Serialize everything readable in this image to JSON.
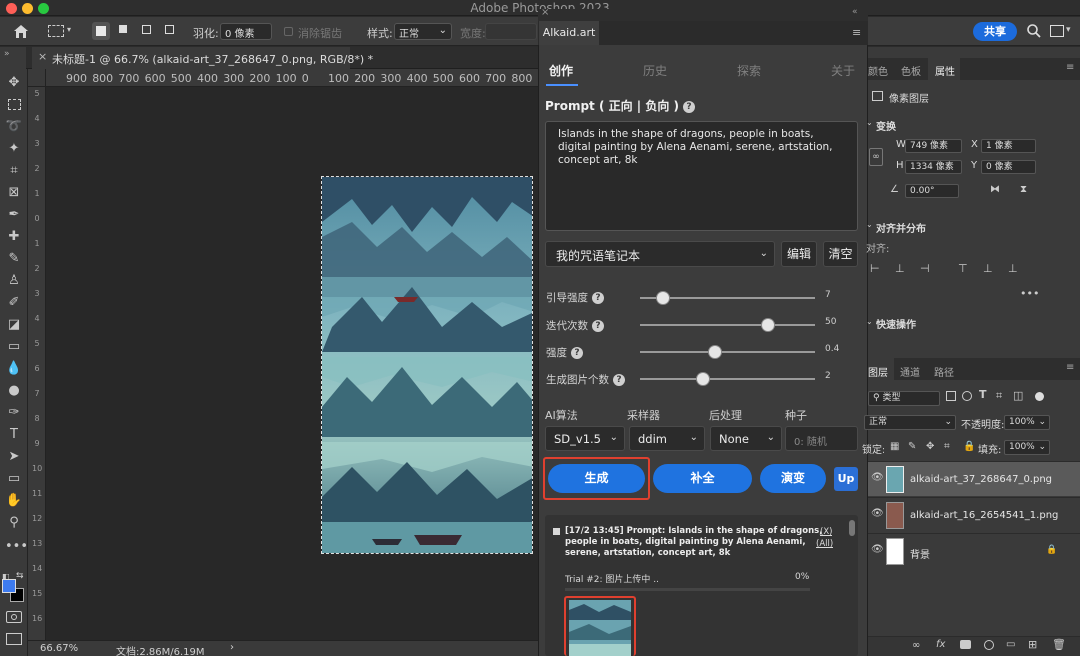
{
  "menubar": {
    "title": "Adobe Photoshop 2023"
  },
  "options_bar": {
    "feather_label": "羽化:",
    "feather_value": "0 像素",
    "antialias_label": "消除锯齿",
    "style_label": "样式:",
    "style_value": "正常",
    "width_label": "宽度:",
    "share_label": "共享"
  },
  "document_tab": {
    "label": "未标题-1 @ 66.7% (alkaid-art_37_268647_0.png, RGB/8*) *"
  },
  "ruler": {
    "h_ticks": [
      "900",
      "800",
      "700",
      "600",
      "500",
      "400",
      "300",
      "200",
      "100",
      "0",
      "100",
      "200",
      "300",
      "400",
      "500",
      "600",
      "700",
      "800",
      "900"
    ],
    "v_ticks": [
      "5",
      "4",
      "3",
      "2",
      "1",
      "0",
      "1",
      "2",
      "3",
      "4",
      "5",
      "6",
      "7",
      "8",
      "9",
      "10",
      "11",
      "12",
      "13",
      "14",
      "15",
      "16"
    ]
  },
  "status_bar": {
    "zoom": "66.67%",
    "doc": "文档:2.86M/6.19M"
  },
  "plugin": {
    "tab_label": "Alkaid.art",
    "nav": [
      "创作",
      "历史",
      "探索",
      "关于"
    ],
    "prompt_label": "Prompt ( 正向 | 负向 )",
    "prompt_text": "Islands in the shape of dragons, people in boats, digital painting by Alena Aenami, serene, artstation, concept art, 8k",
    "notebook_value": "我的咒语笔记本",
    "edit_label": "编辑",
    "clear_label": "清空",
    "sliders": [
      {
        "label": "引导强度",
        "value": "7",
        "fraction": 0.13
      },
      {
        "label": "迭代次数",
        "value": "50",
        "fraction": 0.73
      },
      {
        "label": "强度",
        "value": "0.4",
        "fraction": 0.43
      },
      {
        "label": "生成图片个数",
        "value": "2",
        "fraction": 0.36
      }
    ],
    "columns": {
      "algo": "AI算法",
      "sampler": "采样器",
      "post": "后处理",
      "seed": "种子"
    },
    "algo_value": "SD_v1.5",
    "sampler_value": "ddim",
    "post_value": "None",
    "seed_placeholder": "0: 随机",
    "buttons": {
      "generate": "生成",
      "complete": "补全",
      "evolve": "演变",
      "up": "Up"
    },
    "log": {
      "entry": "[17/2 13:45] Prompt: Islands in the shape of dragons, people in boats, digital painting by Alena Aenami, serene, artstation, concept art, 8k",
      "close_x": "(X)",
      "close_all": "(All)",
      "trial": "Trial #2: 图片上传中 ..",
      "progress": "0%"
    }
  },
  "right_panel": {
    "tabs": [
      "颜色",
      "色板",
      "属性"
    ],
    "pixel_layer": "像素图层",
    "transform": "变换",
    "w_label": "W",
    "w_value": "749 像素",
    "x_label": "X",
    "x_value": "1 像素",
    "h_label": "H",
    "h_value": "1334 像素",
    "y_label": "Y",
    "y_value": "0 像素",
    "angle": "0.00°",
    "align_title": "对齐并分布",
    "align_label": "对齐:",
    "quick_actions": "快速操作",
    "layer_tabs": [
      "图层",
      "通道",
      "路径"
    ],
    "filter_type": "类型",
    "blend_mode": "正常",
    "opacity_label": "不透明度:",
    "opacity_value": "100%",
    "lock_label": "锁定:",
    "fill_label": "填充:",
    "fill_value": "100%",
    "layers": [
      "alkaid-art_37_268647_0.png",
      "alkaid-art_16_2654541_1.png",
      "背景"
    ]
  },
  "colors": {
    "accent": "#1f73e0",
    "highlight": "#e0402f"
  }
}
